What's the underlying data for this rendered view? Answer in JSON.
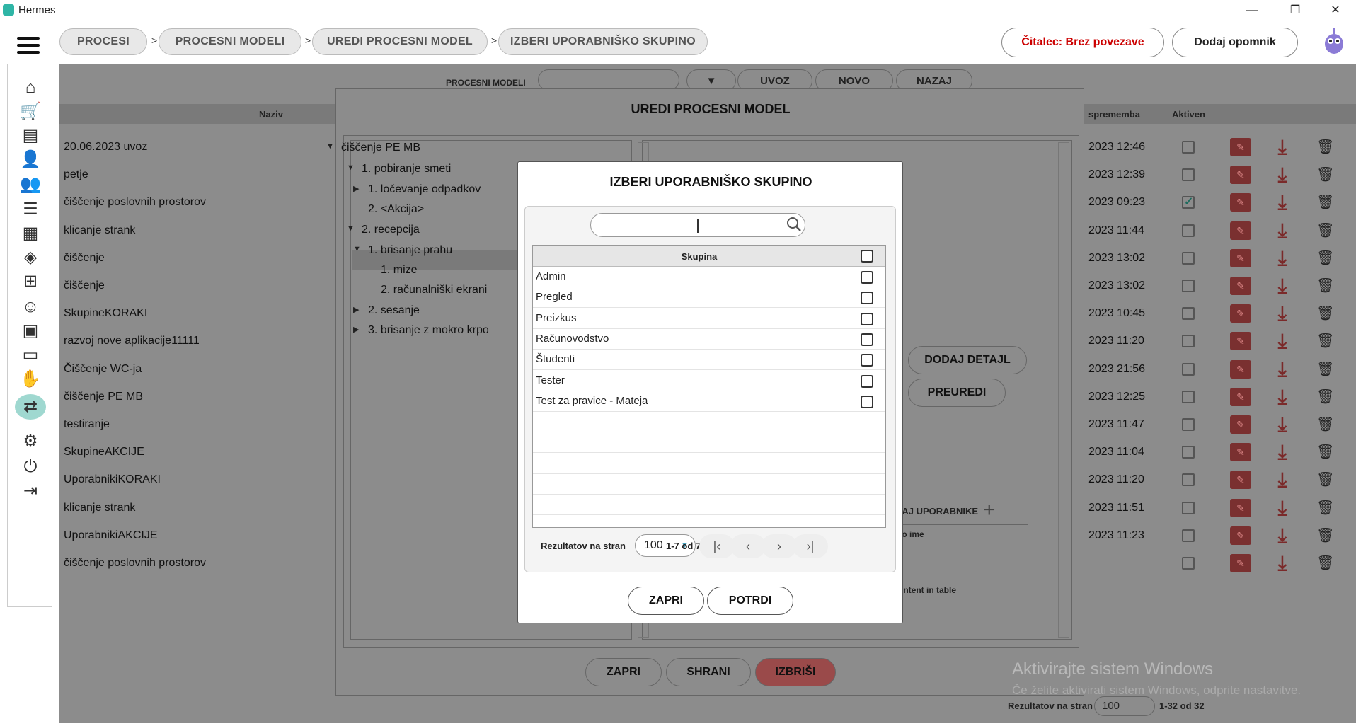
{
  "app": {
    "title": "Hermes"
  },
  "window_controls": {
    "minimize": "—",
    "restore": "❐",
    "close": "✕"
  },
  "breadcrumbs": [
    "PROCESI",
    "PROCESNI MODELI",
    "UREDI PROCESNI MODEL",
    "IZBERI UPORABNIŠKO SKUPINO"
  ],
  "header": {
    "reader_status": "Čitalec: Brez povezave",
    "reminder_button": "Dodaj opomnik",
    "reader_color": "#cc0000"
  },
  "sidebar": {
    "icons": [
      "home-icon",
      "cart-icon",
      "document-icon",
      "user-icon",
      "users-icon",
      "list-icon",
      "calendar-icon",
      "layers-icon",
      "hierarchy-icon",
      "worker-icon",
      "briefcase-icon",
      "chat-icon",
      "handshake-icon",
      "process-icon",
      "gear-icon",
      "power-icon",
      "logout-icon"
    ],
    "active_index": 13
  },
  "toolbar": {
    "label": "PROCESNI MODELI",
    "import": "UVOZ",
    "new": "NOVO",
    "back": "NAZAJ"
  },
  "table": {
    "headers": {
      "name": "Naziv",
      "changed": "sprememba",
      "active": "Aktiven"
    },
    "rows": [
      {
        "name": "20.06.2023 uvoz",
        "date": "2023 12:46",
        "active": false
      },
      {
        "name": "petje",
        "date": "2023 12:39",
        "active": false
      },
      {
        "name": "čiščenje poslovnih prostorov",
        "date": "2023 09:23",
        "active": true
      },
      {
        "name": "klicanje strank",
        "date": "2023 11:44",
        "active": false
      },
      {
        "name": "čiščenje",
        "date": "2023 13:02",
        "active": false
      },
      {
        "name": "čiščenje",
        "date": "2023 13:02",
        "active": false
      },
      {
        "name": "SkupineKORAKI",
        "date": "2023 10:45",
        "active": false
      },
      {
        "name": "razvoj nove aplikacije11111",
        "date": "2023 11:20",
        "active": false
      },
      {
        "name": "Čiščenje WC-ja",
        "date": "2023 21:56",
        "active": false
      },
      {
        "name": "čiščenje PE MB",
        "date": "2023 12:25",
        "active": false
      },
      {
        "name": "testiranje",
        "date": "2023 11:47",
        "active": false
      },
      {
        "name": "SkupineAKCIJE",
        "date": "2023 11:04",
        "active": false
      },
      {
        "name": "UporabnikiKORAKI",
        "date": "2023 11:20",
        "active": false
      },
      {
        "name": "klicanje strank",
        "date": "2023 11:51",
        "active": false
      },
      {
        "name": "UporabnikiAKCIJE",
        "date": "2023 11:23",
        "active": false
      },
      {
        "name": "čiščenje poslovnih prostorov",
        "date": "",
        "active": false
      }
    ],
    "pagination": {
      "label": "Rezultatov na stran",
      "per_page": "100",
      "range": "1-32 od 32"
    }
  },
  "edit_modal": {
    "title": "UREDI PROCESNI MODEL",
    "tree": [
      {
        "label": "čiščenje PE MB",
        "arrow": "▼"
      },
      {
        "label": "1. pobiranje smeti",
        "arrow": "▼"
      },
      {
        "label": "1. ločevanje odpadkov",
        "arrow": "▶"
      },
      {
        "label": "2. <Akcija>",
        "arrow": ""
      },
      {
        "label": "2. recepcija",
        "arrow": "▼"
      },
      {
        "label": "1. brisanje prahu",
        "arrow": "▼"
      },
      {
        "label": "1. mize",
        "arrow": ""
      },
      {
        "label": "2. računalniški ekrani",
        "arrow": ""
      },
      {
        "label": "2. sesanje",
        "arrow": "▶"
      },
      {
        "label": "3.  brisanje z mokro krpo",
        "arrow": "▶"
      }
    ],
    "add_detail": "DODAJ DETAJL",
    "rearrange": "PREUREDI",
    "add_users": "DAJ UPORABNIKE",
    "users_col": "no ime",
    "no_content": "ontent in table",
    "close": "ZAPRI",
    "save": "SHRANI",
    "delete": "IZBRIŠI"
  },
  "dialog": {
    "title": "IZBERI UPORABNIŠKO SKUPINO",
    "search_value": "",
    "column": "Skupina",
    "groups": [
      "Admin",
      "Pregled",
      "Preizkus",
      "Računovodstvo",
      "Študenti",
      "Tester",
      "Test za pravice - Mateja"
    ],
    "per_page_label": "Rezultatov na stran",
    "per_page": "100",
    "range": "1-7 od 7",
    "close": "ZAPRI",
    "confirm": "POTRDI"
  },
  "watermark": {
    "title": "Aktivirajte sistem Windows",
    "subtitle": "Če želite aktivirati sistem Windows, odprite nastavitve."
  }
}
